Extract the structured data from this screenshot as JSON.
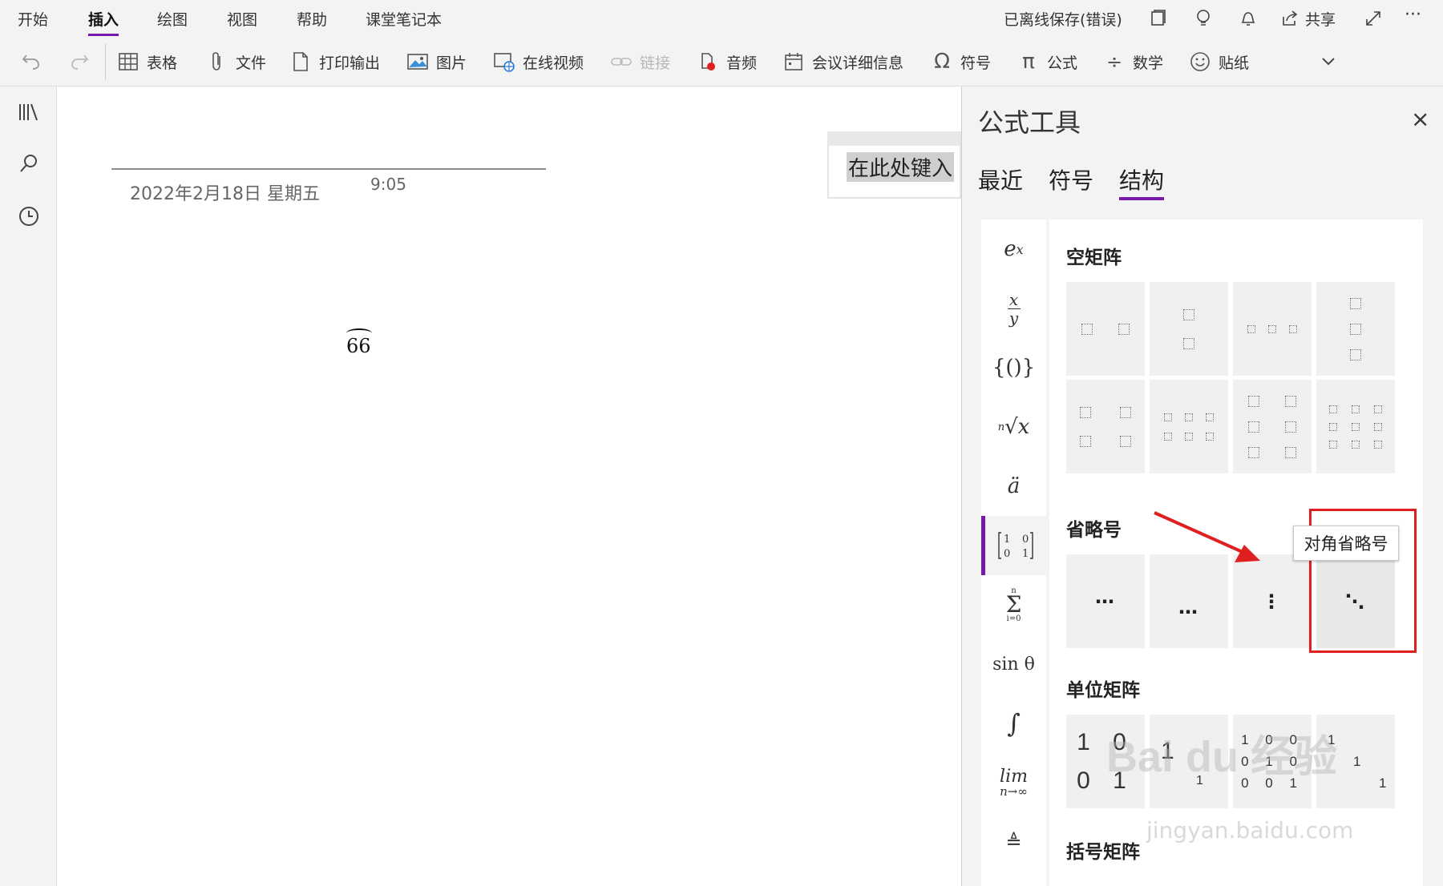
{
  "tabs": [
    "开始",
    "插入",
    "绘图",
    "视图",
    "帮助",
    "课堂笔记本"
  ],
  "active_tab": "插入",
  "status_text": "已离线保存(错误)",
  "share_label": "共享",
  "more_label": "···",
  "toolbar": {
    "table": "表格",
    "file": "文件",
    "printout": "打印输出",
    "picture": "图片",
    "online_video": "在线视频",
    "link": "链接",
    "audio": "音频",
    "meeting": "会议详细信息",
    "symbol": "符号",
    "equation": "公式",
    "math": "数学",
    "sticker": "贴纸"
  },
  "canvas": {
    "date": "2022年2月18日 星期五",
    "time": "9:05",
    "formula": "66",
    "type_here": "在此处键入"
  },
  "pane": {
    "title": "公式工具",
    "close": "×",
    "tabs": [
      "最近",
      "符号",
      "结构"
    ],
    "active_tab": "结构",
    "categories": [
      "eˣ",
      "x/y",
      "{()}",
      "ⁿ√x",
      "ä",
      "matrix",
      "Σ",
      "sin θ",
      "∫",
      "lim",
      "≜"
    ],
    "sections": {
      "empty_matrix": "空矩阵",
      "ellipsis": "省略号",
      "identity_matrix": "单位矩阵",
      "bracket_matrix": "括号矩阵"
    },
    "ellipsis_items": [
      "⋯",
      "…",
      "⋮",
      "⋱"
    ],
    "identity_items": [
      [
        "1 0",
        "0 1"
      ],
      [
        "1",
        "1"
      ],
      [
        "1 0 0",
        "0 1 0",
        "0 0 1"
      ],
      [
        "1",
        "1",
        "1"
      ]
    ],
    "tooltip": "对角省略号",
    "highlight_color": "#e02020",
    "accent_color": "#7719aa"
  },
  "watermark": {
    "main": "Bai du 经验",
    "sub": "jingyan.baidu.com"
  }
}
